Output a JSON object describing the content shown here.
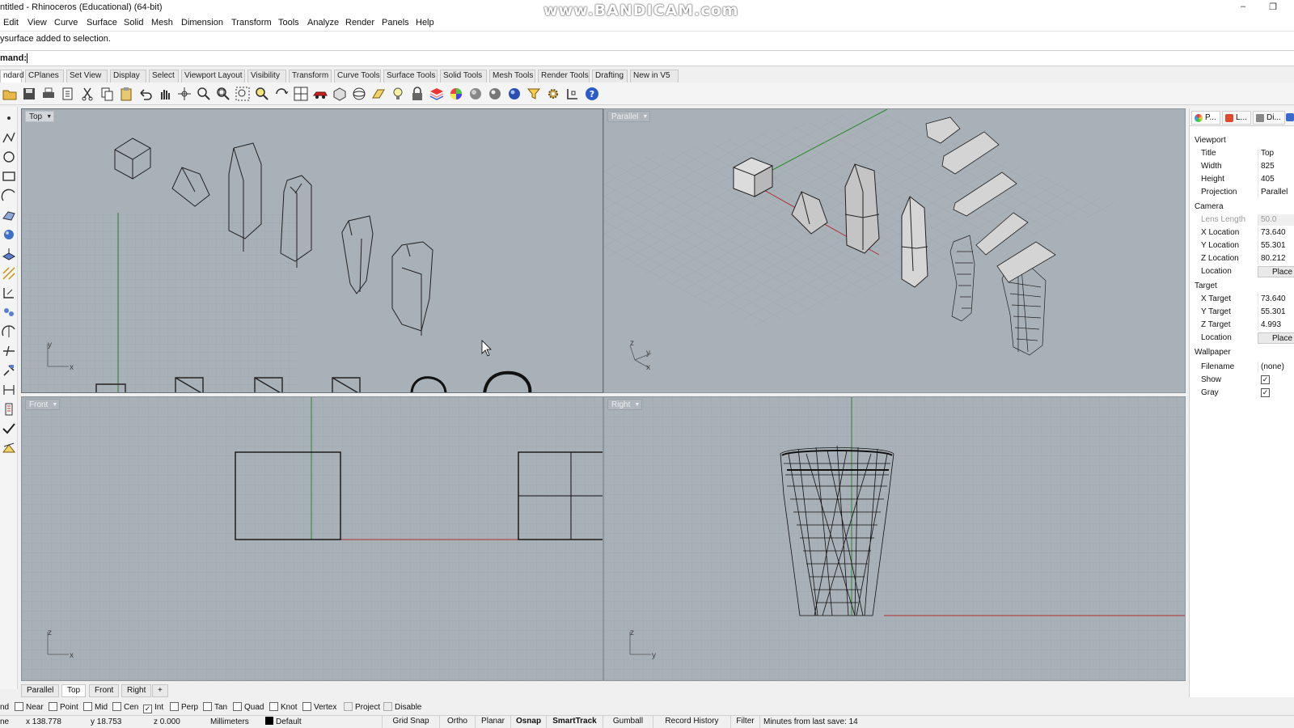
{
  "window": {
    "title": "ntitled - Rhinoceros (Educational) (64-bit)",
    "watermark": "www.BANDICAM.com",
    "minimize": "–",
    "restore": "❐"
  },
  "menu": [
    "Edit",
    "View",
    "Curve",
    "Surface",
    "Solid",
    "Mesh",
    "Dimension",
    "Transform",
    "Tools",
    "Analyze",
    "Render",
    "Panels",
    "Help"
  ],
  "command": {
    "history": "ysurface added to selection.",
    "prompt": "mand:"
  },
  "toolbar_tabs": [
    "ndard",
    "CPlanes",
    "Set View",
    "Display",
    "Select",
    "Viewport Layout",
    "Visibility",
    "Transform",
    "Curve Tools",
    "Surface Tools",
    "Solid Tools",
    "Mesh Tools",
    "Render Tools",
    "Drafting",
    "New in V5"
  ],
  "toolbar_icons": [
    "open-icon",
    "save-icon",
    "print-icon",
    "import-icon",
    "cut-icon",
    "copy-icon",
    "paste-icon",
    "undo-icon",
    "pan-icon",
    "rotate-view-icon",
    "zoom-icon",
    "zoom-extents-icon",
    "zoom-window-icon",
    "zoom-selected-icon",
    "four-viewports-icon",
    "car-icon",
    "isometric-icon",
    "sphere-view-icon",
    "light-icon",
    "lock-icon",
    "layer-icon",
    "color-wheel-icon",
    "shaded-sphere-icon",
    "rendered-sphere-icon",
    "ghosted-sphere-icon",
    "render-blue-sphere-icon",
    "select-filter-icon",
    "gear-icon",
    "osnap-icon",
    "help-icon"
  ],
  "left_tools": [
    "point-icon",
    "polyline-icon",
    "circle-icon",
    "rectangle-icon",
    "arc-icon",
    "surface-icon",
    "solid-box-icon",
    "extrude-icon",
    "fillet-icon",
    "transform-icon",
    "group-icon",
    "trim-icon",
    "split-icon",
    "move-icon",
    "dimension-icon",
    "text-icon",
    "check-icon",
    "analyze-icon"
  ],
  "viewports": {
    "top": {
      "label": "Top",
      "axes": [
        "y",
        "x"
      ]
    },
    "parallel": {
      "label": "Parallel",
      "axes": [
        "z",
        "y",
        "x"
      ]
    },
    "front": {
      "label": "Front",
      "axes": [
        "z",
        "x"
      ]
    },
    "right": {
      "label": "Right",
      "axes": [
        "z",
        "y"
      ]
    }
  },
  "viewport_tabs": [
    "Parallel",
    "Top",
    "Front",
    "Right",
    "+"
  ],
  "osnap": [
    {
      "label": "nd",
      "checked": null
    },
    {
      "label": "Near",
      "checked": false
    },
    {
      "label": "Point",
      "checked": false
    },
    {
      "label": "Mid",
      "checked": false
    },
    {
      "label": "Cen",
      "checked": false
    },
    {
      "label": "Int",
      "checked": true
    },
    {
      "label": "Perp",
      "checked": false
    },
    {
      "label": "Tan",
      "checked": false
    },
    {
      "label": "Quad",
      "checked": false
    },
    {
      "label": "Knot",
      "checked": false
    },
    {
      "label": "Vertex",
      "checked": false
    },
    {
      "label": "Project",
      "checked": false,
      "disabled": true
    },
    {
      "label": "Disable",
      "checked": false,
      "disabled": true
    }
  ],
  "status": {
    "plane": "ne",
    "x": "x 138.778",
    "y": "y 18.753",
    "z": "z 0.000",
    "units": "Millimeters",
    "layer": "Default",
    "panes": [
      "Grid Snap",
      "Ortho",
      "Planar",
      "Osnap",
      "SmartTrack",
      "Gumball",
      "Record History",
      "Filter"
    ],
    "save": "Minutes from last save: 14"
  },
  "properties": {
    "tabs": [
      "P...",
      "L...",
      "Di..."
    ],
    "groups": {
      "viewport": "Viewport",
      "camera": "Camera",
      "target": "Target",
      "wallpaper": "Wallpaper"
    },
    "viewport": {
      "title_k": "Title",
      "title_v": "Top",
      "width_k": "Width",
      "width_v": "825",
      "height_k": "Height",
      "height_v": "405",
      "projection_k": "Projection",
      "projection_v": "Parallel"
    },
    "camera": {
      "lens_k": "Lens Length",
      "lens_v": "50.0",
      "xloc_k": "X Location",
      "xloc_v": "73.640",
      "yloc_k": "Y Location",
      "yloc_v": "55.301",
      "zloc_k": "Z Location",
      "zloc_v": "80.212",
      "loc_k": "Location",
      "loc_btn": "Place"
    },
    "target": {
      "xt_k": "X Target",
      "xt_v": "73.640",
      "yt_k": "Y Target",
      "yt_v": "55.301",
      "zt_k": "Z Target",
      "zt_v": "4.993",
      "loc_k": "Location",
      "loc_btn": "Place"
    },
    "wallpaper": {
      "file_k": "Filename",
      "file_v": "(none)",
      "show_k": "Show",
      "show_v": true,
      "gray_k": "Gray",
      "gray_v": true
    }
  }
}
